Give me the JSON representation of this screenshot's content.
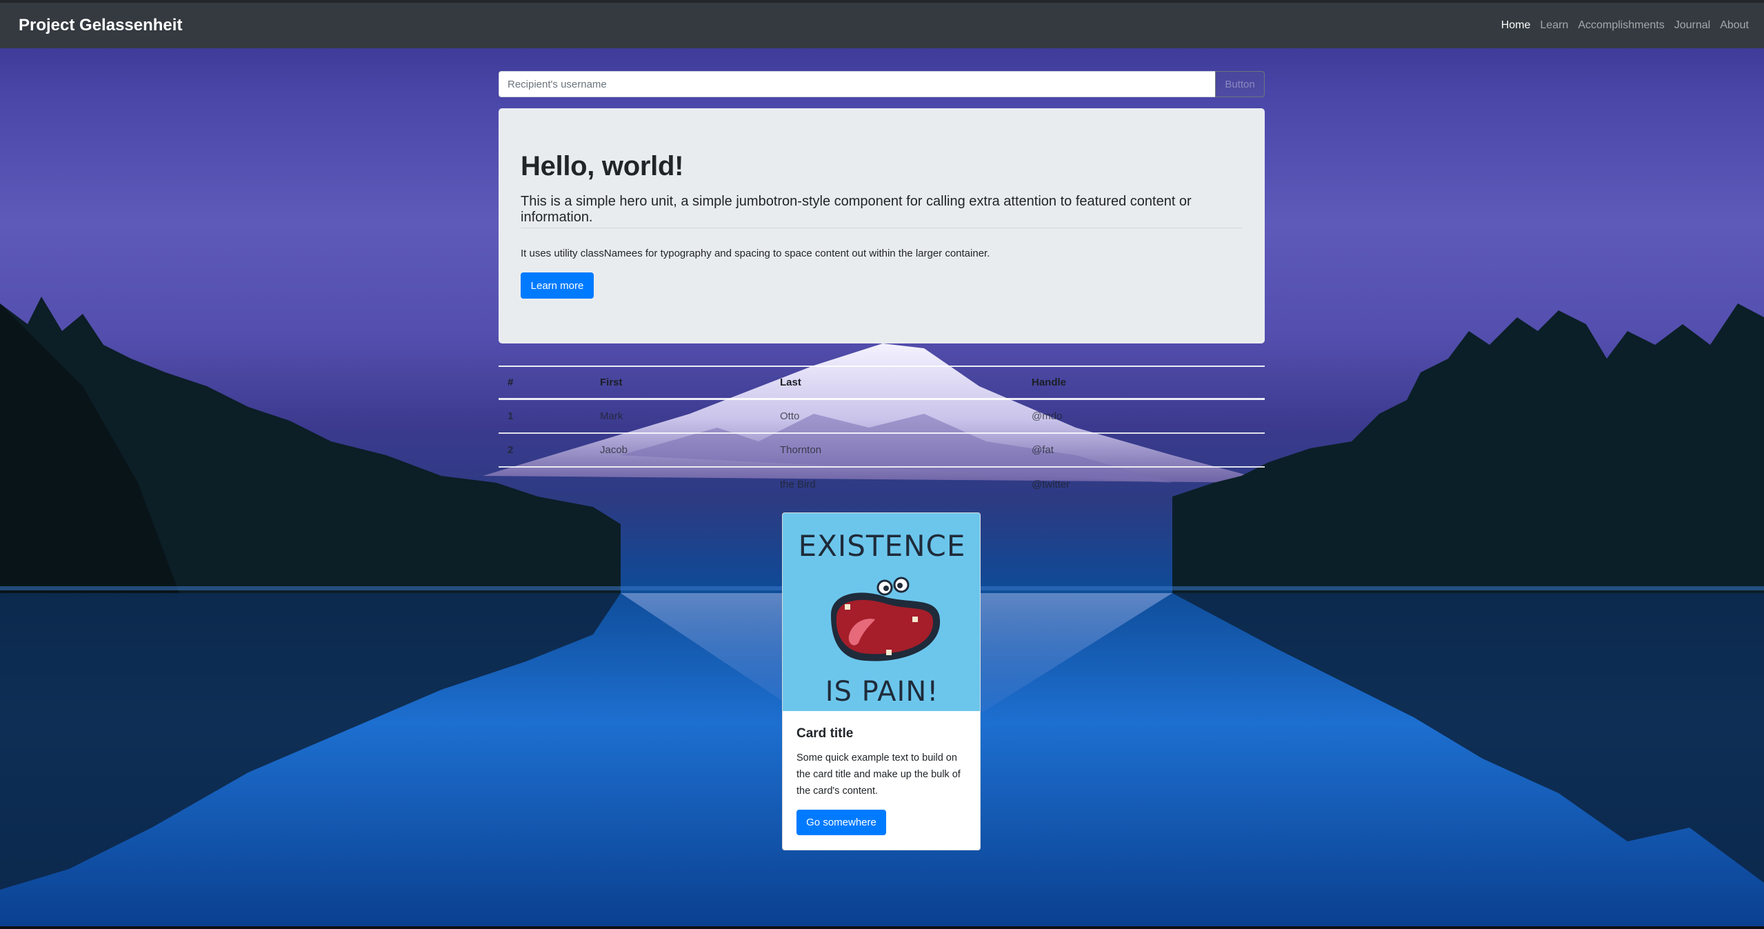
{
  "navbar": {
    "brand": "Project Gelassenheit",
    "links": [
      {
        "label": "Home",
        "active": true
      },
      {
        "label": "Learn",
        "active": false
      },
      {
        "label": "Accomplishments",
        "active": false
      },
      {
        "label": "Journal",
        "active": false
      },
      {
        "label": "About",
        "active": false
      }
    ]
  },
  "search": {
    "placeholder": "Recipient's username",
    "button_label": "Button"
  },
  "jumbotron": {
    "title": "Hello, world!",
    "lead": "This is a simple hero unit, a simple jumbotron-style component for calling extra attention to featured content or information.",
    "description": "It uses utility classNamees for typography and spacing to space content out within the larger container.",
    "button_label": "Learn more"
  },
  "table": {
    "headers": [
      "#",
      "First",
      "Last",
      "Handle"
    ],
    "rows": [
      [
        "1",
        "Mark",
        "Otto",
        "@mdo"
      ],
      [
        "2",
        "Jacob",
        "Thornton",
        "@fat"
      ],
      [
        "",
        "",
        "the Bird",
        "@twitter"
      ]
    ]
  },
  "card": {
    "image_text_top": "EXISTENCE",
    "image_text_bottom": "IS PAIN!",
    "title": "Card title",
    "text": "Some quick example text to build on the card title and make up the bulk of the card's content.",
    "button_label": "Go somewhere"
  },
  "colors": {
    "navbar_bg": "#343a40",
    "primary": "#007bff",
    "jumbotron_bg": "#e9ecef",
    "card_image_bg": "#6cc6ec"
  }
}
